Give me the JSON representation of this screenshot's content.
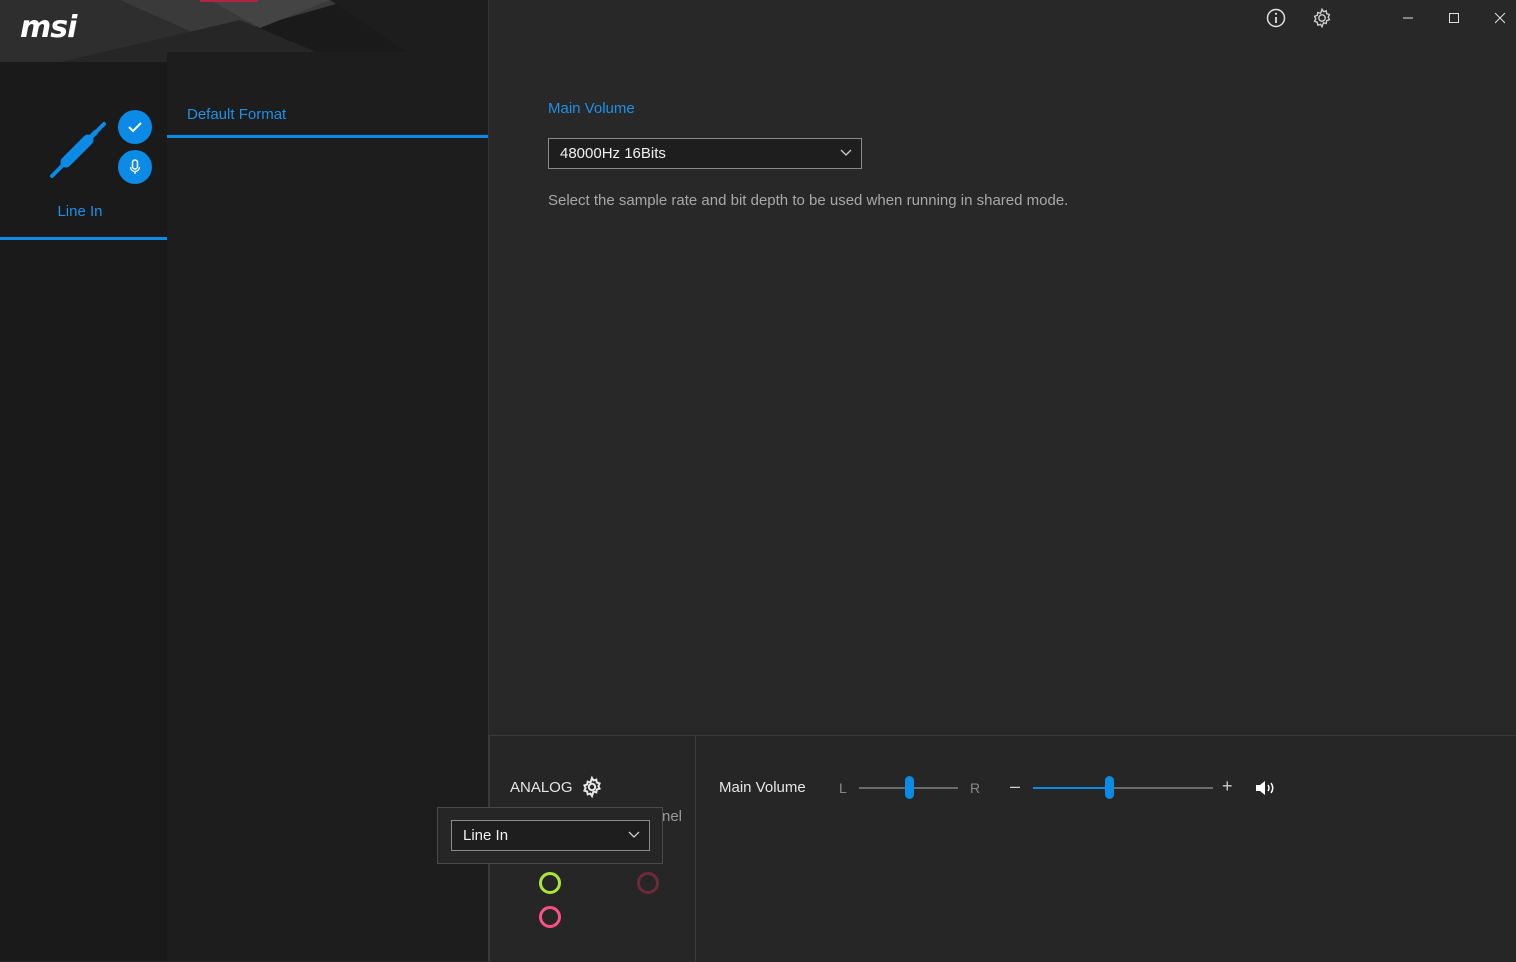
{
  "app": {
    "logo": "msi",
    "accent_color": "#0b8ae6"
  },
  "sidebar": {
    "device_label": "Line In",
    "device_icon": "audio-jack-icon",
    "badges": [
      "check-icon",
      "microphone-icon"
    ]
  },
  "tabs": [
    {
      "label": "Default Format",
      "active": true
    }
  ],
  "main": {
    "section_label": "Main Volume",
    "format_select_value": "48000Hz 16Bits",
    "description": "Select the sample rate and bit depth to be used when running in shared mode."
  },
  "titlebar": {
    "icons": [
      "info-icon",
      "gear-icon",
      "minimize-icon",
      "maximize-icon",
      "close-icon"
    ]
  },
  "bottom": {
    "analog_label": "ANALOG",
    "hidden_text": "nel",
    "popup_select_value": "Line In",
    "jacks": [
      {
        "name": "green-jack",
        "color": "#a8e63a"
      },
      {
        "name": "dark-red-jack",
        "color": "#6e2a38"
      },
      {
        "name": "pink-jack",
        "color": "#ff4f87"
      }
    ],
    "main_volume_label": "Main Volume",
    "balance_left": "L",
    "balance_right": "R",
    "balance_value": 0.5,
    "volume_minus": "–",
    "volume_plus": "+",
    "volume_value": 0.42
  }
}
